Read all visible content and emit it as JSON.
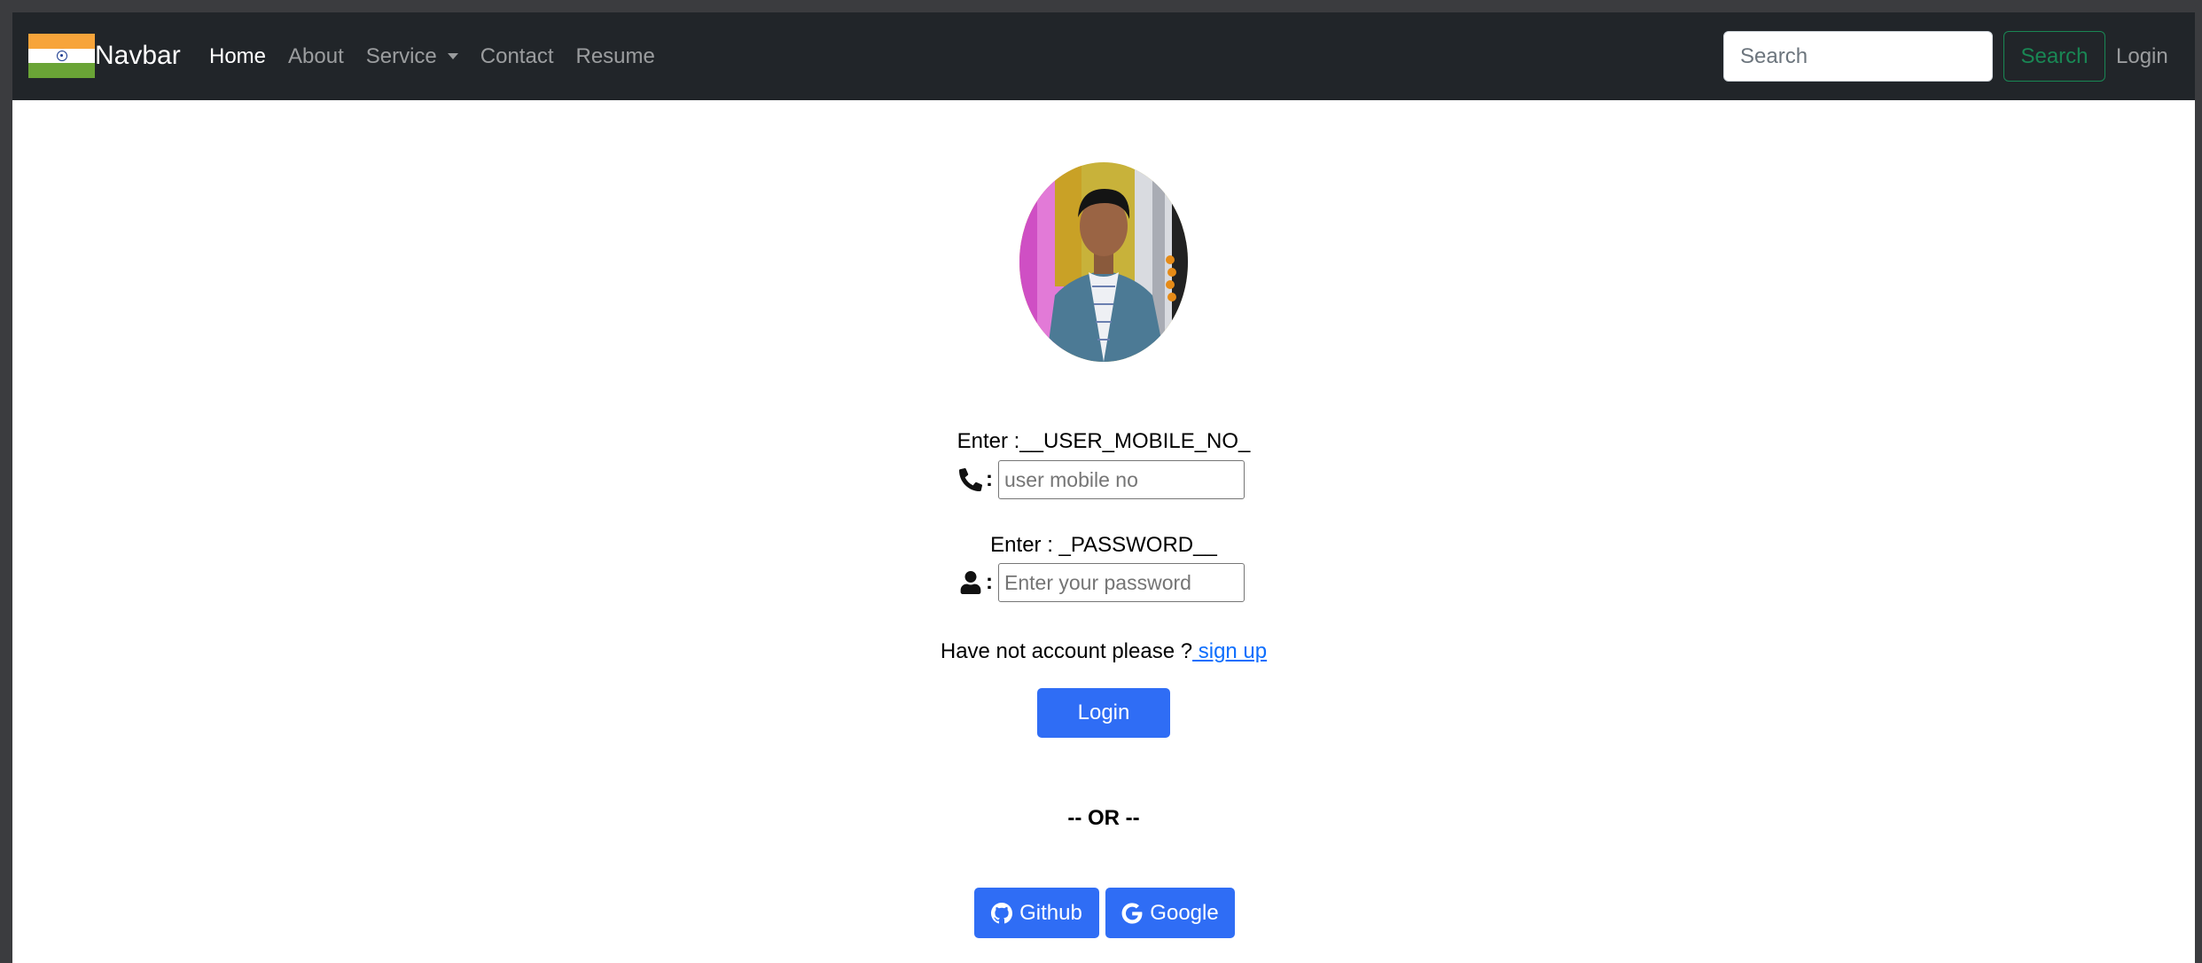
{
  "navbar": {
    "brand": "Navbar",
    "links": [
      {
        "label": "Home",
        "active": true
      },
      {
        "label": "About",
        "active": false
      },
      {
        "label": "Service",
        "active": false,
        "dropdown": true
      },
      {
        "label": "Contact",
        "active": false
      },
      {
        "label": "Resume",
        "active": false
      }
    ],
    "search_placeholder": "Search",
    "search_button": "Search",
    "login": "Login"
  },
  "form": {
    "mobile_prompt": "Enter :__USER_MOBILE_NO_",
    "mobile_placeholder": "user mobile no",
    "password_prompt": "Enter : _PASSWORD__",
    "password_placeholder": "Enter your password",
    "colon": ":",
    "signup_text": "Have not account please ?",
    "signup_link": " sign up",
    "login_button": "Login",
    "or_text": "-- OR --",
    "github_button": "Github",
    "google_button": "Google"
  },
  "colors": {
    "navbar_bg": "#212529",
    "primary": "#2f6df5",
    "success": "#198754",
    "link": "#0d6efd"
  },
  "icons": {
    "brand": "india-flag-icon",
    "mobile": "phone-icon",
    "password": "user-icon",
    "github": "github-icon",
    "google": "google-icon"
  }
}
